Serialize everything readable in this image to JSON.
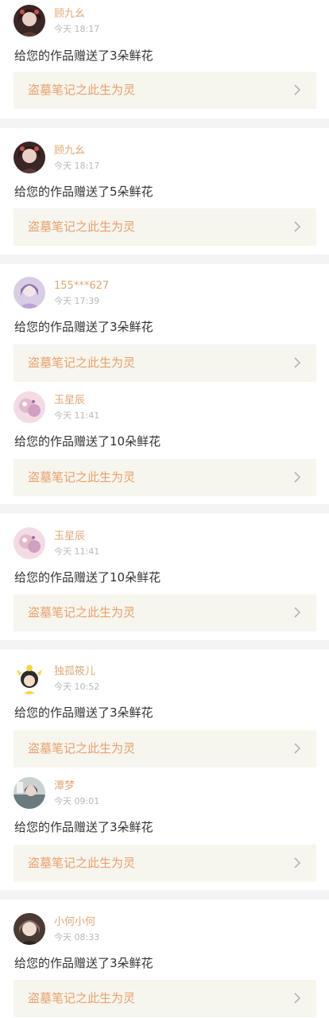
{
  "colors": {
    "accent": "#e0a878",
    "link": "#e9a06c",
    "time": "#b8b8b8",
    "text": "#333333",
    "card_bg": "#ffffff",
    "work_bg": "#f6f5ee",
    "page_bg": "#f4f4f4"
  },
  "items": [
    {
      "name": "顾九幺",
      "time": "今天 18:17",
      "message": "给您的作品赠送了3朵鲜花",
      "work": "盗墓笔记之此生为灵",
      "avatar_color": "#5a3a36",
      "chevron_icon": "chevron-right-icon"
    },
    {
      "name": "顾九幺",
      "time": "今天 18:17",
      "message": "给您的作品赠送了5朵鲜花",
      "work": "盗墓笔记之此生为灵",
      "avatar_color": "#5a3a36",
      "chevron_icon": "chevron-right-icon"
    },
    {
      "name": "155***627",
      "time": "今天 17:39",
      "message": "给您的作品赠送了3朵鲜花",
      "work": "盗墓笔记之此生为灵",
      "avatar_color": "#b9a3d3",
      "chevron_icon": "chevron-right-icon"
    },
    {
      "name": "玉星辰",
      "time": "今天 11:41",
      "message": "给您的作品赠送了10朵鲜花",
      "work": "盗墓笔记之此生为灵",
      "avatar_color": "#e4b9cc",
      "chevron_icon": "chevron-right-icon"
    },
    {
      "name": "玉星辰",
      "time": "今天 11:41",
      "message": "给您的作品赠送了10朵鲜花",
      "work": "盗墓笔记之此生为灵",
      "avatar_color": "#e4b9cc",
      "chevron_icon": "chevron-right-icon"
    },
    {
      "name": "独孤筱儿",
      "time": "今天 10:52",
      "message": "给您的作品赠送了3朵鲜花",
      "work": "盗墓笔记之此生为灵",
      "avatar_color": "#f4d44a",
      "chevron_icon": "chevron-right-icon"
    },
    {
      "name": "潭梦",
      "time": "今天 09:01",
      "message": "给您的作品赠送了3朵鲜花",
      "work": "盗墓笔记之此生为灵",
      "avatar_color": "#6b7a7c",
      "chevron_icon": "chevron-right-icon"
    },
    {
      "name": "小何小何",
      "time": "今天 08:33",
      "message": "给您的作品赠送了3朵鲜花",
      "work": "盗墓笔记之此生为灵",
      "avatar_color": "#8a6e62",
      "chevron_icon": "chevron-right-icon"
    }
  ]
}
